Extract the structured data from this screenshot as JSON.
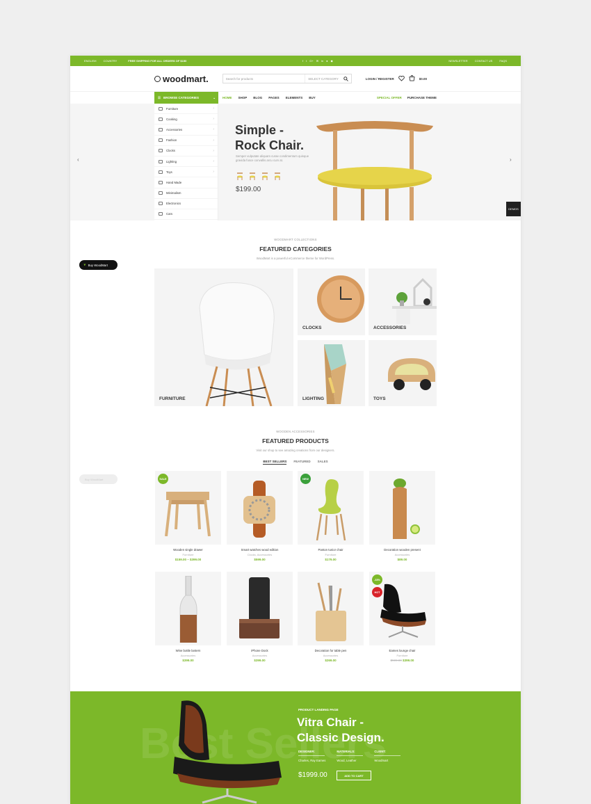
{
  "topbar": {
    "lang": "ENGLISH",
    "currency": "COUNTRY",
    "shipping": "FREE SHIPPING FOR ALL ORDERS OF $150",
    "newsletter": "NEWSLETTER",
    "contact": "CONTACT US",
    "faqs": "FAQS",
    "social": [
      "f",
      "t",
      "G+",
      "✉",
      "in",
      "●",
      "◆"
    ]
  },
  "header": {
    "logo": "woodmart.",
    "search_placeholder": "Search for products",
    "select_category": "SELECT CATEGORY",
    "login": "LOGIN / REGISTER",
    "cart_total": "$0.00"
  },
  "nav": {
    "browse": "BROWSE CATEGORIES",
    "menu": [
      "HOME",
      "SHOP",
      "BLOG",
      "PAGES",
      "ELEMENTS",
      "BUY"
    ],
    "special": "SPECIAL OFFER",
    "purchase": "PURCHASE THEME"
  },
  "categories": [
    "Furniture",
    "Cooking",
    "Accessories",
    "Fashion",
    "Clocks",
    "Lighting",
    "Toys",
    "Hand Made",
    "Minimalism",
    "Electronics",
    "Cars"
  ],
  "hero": {
    "title1": "Simple -",
    "title2": "Rock Chair.",
    "subtitle": "Semper vulputate aliquam curae condimentum quisque gravida fusce convallis arcu cum at.",
    "price": "$199.00",
    "demos": "DEMOS"
  },
  "buy_pill": "Buy WoodMart",
  "featured_categories": {
    "small": "WOODMART COLLECTIONS",
    "title": "FEATURED CATEGORIES",
    "desc": "WoodMart is a powerful eCommerce theme for WordPress.",
    "tiles": [
      "FURNITURE",
      "CLOCKS",
      "ACCESSORIES",
      "LIGHTING",
      "TOYS"
    ]
  },
  "featured_products": {
    "small": "WOODEN ACCESSORIES",
    "title": "FEATURED PRODUCTS",
    "desc": "Visit our shop to see amazing creations from our designers.",
    "tabs": [
      "BEST SELLERS",
      "FEATURED",
      "SALES"
    ]
  },
  "products": [
    {
      "name": "Wooden single drawer",
      "cat": "Furniture",
      "price": "$159.00 – $399.00",
      "badge": "SALE"
    },
    {
      "name": "Smart watches wood edition",
      "cat": "Clocks, Accessories",
      "price": "$599.00",
      "badge": ""
    },
    {
      "name": "Panton tunior chair",
      "cat": "Furniture",
      "price": "$179.00",
      "badge": "NEW"
    },
    {
      "name": "Decoration wooden present",
      "cat": "Accessories",
      "price": "$89.00",
      "badge": ""
    },
    {
      "name": "Wine bottle lantern",
      "cat": "Accessories",
      "price": "$399.00",
      "badge": ""
    },
    {
      "name": "iPhone Dock",
      "cat": "Accessories",
      "price": "$399.00",
      "badge": ""
    },
    {
      "name": "Decoration for table pen",
      "cat": "Accessories",
      "price": "$269.00",
      "badge": ""
    },
    {
      "name": "Eames lounge chair",
      "cat": "Furniture",
      "price": "$399.00",
      "old_price": "$599.00",
      "badge": "-33%",
      "badge2": "HOT"
    }
  ],
  "banner": {
    "small": "PRODUCT LANDING PAGE",
    "title1": "Vitra Chair -",
    "title2": "Classic Design.",
    "bg_text": "Best Sellers",
    "designer_h": "DESIGNER:",
    "designer": "Charles, Ray Eames",
    "material_h": "MATERIALS:",
    "material": "Wood, Leather",
    "client_h": "CLIENT:",
    "client": "Woodmart",
    "price": "$1999.00",
    "button": "ADD TO CART"
  },
  "colors": {
    "accent": "#7cb829",
    "dark": "#222222"
  }
}
